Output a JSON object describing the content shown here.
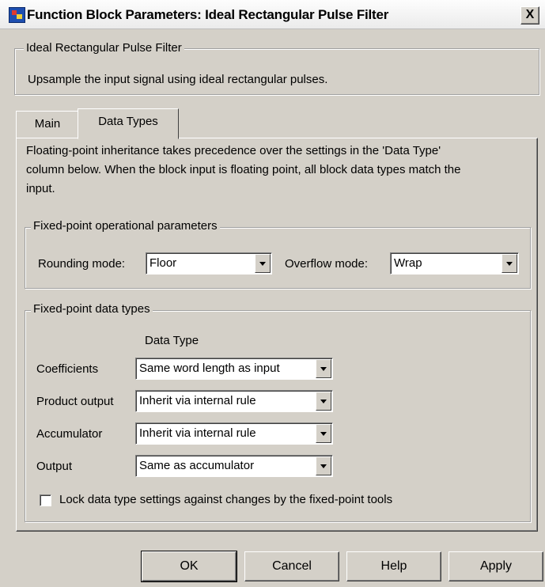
{
  "window": {
    "title": "Function Block Parameters: Ideal Rectangular Pulse Filter",
    "close_glyph": "X"
  },
  "block_group": {
    "legend": "Ideal Rectangular Pulse Filter",
    "description": "Upsample the input signal using ideal rectangular pulses."
  },
  "tabs": [
    {
      "label": "Main",
      "active": false
    },
    {
      "label": "Data Types",
      "active": true
    }
  ],
  "info": {
    "line1": "Floating-point inheritance takes precedence over the settings in the 'Data Type'",
    "line2": "column below. When the block input is floating point, all block data types match the",
    "line3": "input."
  },
  "operational": {
    "legend": "Fixed-point operational parameters",
    "rounding_label": "Rounding mode:",
    "rounding_value": "Floor",
    "overflow_label": "Overflow mode:",
    "overflow_value": "Wrap"
  },
  "datatypes": {
    "legend": "Fixed-point data types",
    "column_header": "Data Type",
    "rows": [
      {
        "label": "Coefficients",
        "value": "Same word length as input"
      },
      {
        "label": "Product output",
        "value": "Inherit via internal rule"
      },
      {
        "label": "Accumulator",
        "value": "Inherit via internal rule"
      },
      {
        "label": "Output",
        "value": "Same as accumulator"
      }
    ],
    "lock_label": "Lock data type settings against changes by the fixed-point tools",
    "lock_checked": false
  },
  "buttons": {
    "ok": "OK",
    "cancel": "Cancel",
    "help": "Help",
    "apply": "Apply"
  }
}
